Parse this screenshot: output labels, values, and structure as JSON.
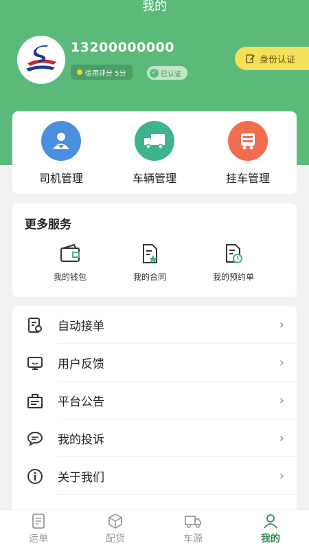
{
  "header": {
    "title": "我的",
    "phone": "13200000000",
    "credit_score": "信用评分 5分",
    "verified": "已认证",
    "id_auth_button": "身份认证"
  },
  "management": [
    {
      "label": "司机管理",
      "icon": "driver-icon",
      "color": "#4a8fe0"
    },
    {
      "label": "车辆管理",
      "icon": "truck-icon",
      "color": "#3fb38a"
    },
    {
      "label": "挂车管理",
      "icon": "trailer-icon",
      "color": "#f06d4e"
    }
  ],
  "services": {
    "title": "更多服务",
    "items": [
      {
        "label": "我的钱包",
        "icon": "wallet-icon"
      },
      {
        "label": "我的合同",
        "icon": "contract-icon"
      },
      {
        "label": "我的预约单",
        "icon": "appointment-icon"
      }
    ]
  },
  "menu": [
    {
      "label": "自动接单",
      "icon": "auto-order-icon"
    },
    {
      "label": "用户反馈",
      "icon": "feedback-icon"
    },
    {
      "label": "平台公告",
      "icon": "announcement-icon"
    },
    {
      "label": "我的投诉",
      "icon": "complaint-icon"
    },
    {
      "label": "关于我们",
      "icon": "info-icon"
    }
  ],
  "tabbar": [
    {
      "label": "运单",
      "icon": "waybill-icon",
      "active": false
    },
    {
      "label": "配货",
      "icon": "box-icon",
      "active": false
    },
    {
      "label": "车源",
      "icon": "truck-icon",
      "active": false
    },
    {
      "label": "我的",
      "icon": "user-icon",
      "active": true
    }
  ],
  "colors": {
    "brand_green": "#5bba7a",
    "active_tab": "#2f8a52",
    "id_button": "#f6e05a"
  }
}
